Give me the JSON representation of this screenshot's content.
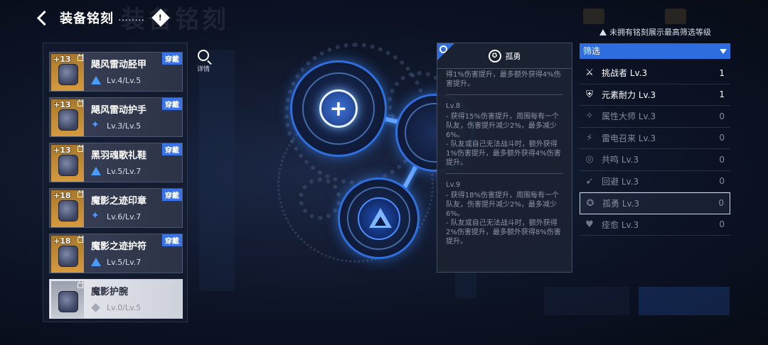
{
  "header": {
    "title": "装备铭刻",
    "dots": "……..",
    "info_icon_label": "!",
    "background_title": "装备铭刻"
  },
  "equipment": [
    {
      "plus": "+13",
      "name": "飓风雷动胫甲",
      "level": "Lv.4/Lv.5",
      "level_icon": "triangle-rank-icon",
      "badge": "穿戴",
      "selected": false
    },
    {
      "plus": "+13",
      "name": "飓风雷动护手",
      "level": "Lv.3/Lv.5",
      "level_icon": "star-rank-icon",
      "badge": "穿戴",
      "selected": false
    },
    {
      "plus": "+13",
      "name": "黑羽魂歌礼鞋",
      "level": "Lv.5/Lv.7",
      "level_icon": "triangle-rank-icon",
      "badge": "穿戴",
      "selected": false
    },
    {
      "plus": "+18",
      "name": "魔影之迹印章",
      "level": "Lv.6/Lv.7",
      "level_icon": "star-rank-icon",
      "badge": "穿戴",
      "selected": false
    },
    {
      "plus": "+18",
      "name": "魔影之迹护符",
      "level": "Lv.5/Lv.7",
      "level_icon": "triangle-rank-icon",
      "badge": "穿戴",
      "selected": false
    },
    {
      "plus": "",
      "name": "魔影护腕",
      "level": "Lv.0/Lv.5",
      "level_icon": "diamond-rank-icon",
      "badge": "",
      "selected": true
    }
  ],
  "detail": {
    "label": "详情"
  },
  "tooltip": {
    "title": "孤勇",
    "intro": "得1%伤害提升，最多额外获得4%伤害提升。",
    "sections": [
      {
        "level": "Lv.8",
        "lines": [
          "- 获得15%伤害提升，周围每有一个队友，伤害提升减少2%，最多减少6%。",
          "- 队友或自己无法战斗时，额外获得1%伤害提升，最多额外获得4%伤害提升。"
        ]
      },
      {
        "level": "Lv.9",
        "lines": [
          "- 获得18%伤害提升，周围每有一个队友，伤害提升减少2%，最多减少6%。",
          "- 队友或自己无法战斗时，额外获得2%伤害提升，最多额外获得8%伤害提升。"
        ]
      }
    ]
  },
  "notice": "未拥有铭刻展示最高筛选等级",
  "filter": {
    "label": "筛选",
    "items": [
      {
        "icon": "challenger-icon",
        "glyph": "⚔",
        "name": "挑战者 Lv.3",
        "count": "1",
        "active": true,
        "selected": false
      },
      {
        "icon": "shield-icon",
        "glyph": "⛨",
        "name": "元素耐力 Lv.3",
        "count": "1",
        "active": true,
        "selected": false
      },
      {
        "icon": "attribute-master-icon",
        "glyph": "✧",
        "name": "属性大师 Lv.3",
        "count": "0",
        "active": false,
        "selected": false
      },
      {
        "icon": "thunder-summon-icon",
        "glyph": "⚡",
        "name": "雷电召来 Lv.3",
        "count": "0",
        "active": false,
        "selected": false
      },
      {
        "icon": "resonance-icon",
        "glyph": "◎",
        "name": "共鸣 Lv.3",
        "count": "0",
        "active": false,
        "selected": false
      },
      {
        "icon": "evade-icon",
        "glyph": "➹",
        "name": "回避 Lv.3",
        "count": "0",
        "active": false,
        "selected": false
      },
      {
        "icon": "lone-brave-icon",
        "glyph": "✪",
        "name": "孤勇 Lv.3",
        "count": "0",
        "active": false,
        "selected": true
      },
      {
        "icon": "heal-icon",
        "glyph": "♥",
        "name": "痊愈 Lv.3",
        "count": "0",
        "active": false,
        "selected": false
      }
    ]
  }
}
